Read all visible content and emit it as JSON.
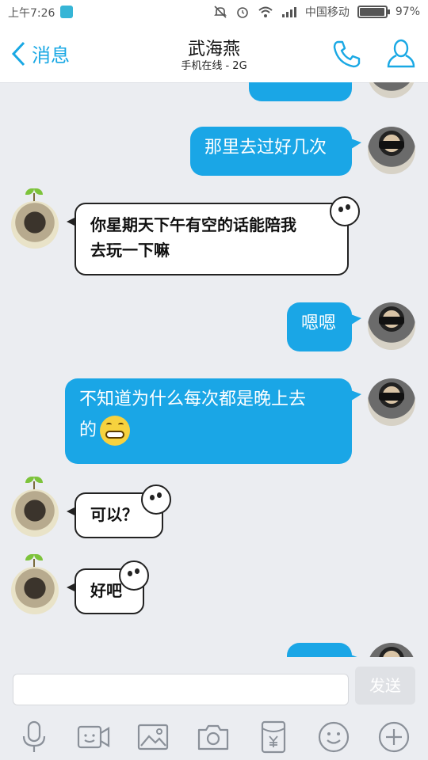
{
  "status_bar": {
    "time": "上午7:26",
    "carrier": "中国移动",
    "battery": "97%"
  },
  "header": {
    "back_label": "消息",
    "title": "武海燕",
    "subtitle": "手机在线 - 2G"
  },
  "messages": [
    {
      "side": "right",
      "style": "blue",
      "text": "那里去过好几次"
    },
    {
      "side": "left",
      "style": "white",
      "line1": "你星期天下午有空的话能陪我",
      "line2": "去玩一下嘛"
    },
    {
      "side": "right",
      "style": "blue",
      "text": "嗯嗯"
    },
    {
      "side": "right",
      "style": "blue",
      "line1": "不知道为什么每次都是晚上去",
      "line2": "的"
    },
    {
      "side": "left",
      "style": "white",
      "text": "可以？"
    },
    {
      "side": "left",
      "style": "white",
      "text": "好吧"
    }
  ],
  "composer": {
    "placeholder": "",
    "send_label": "发送"
  },
  "toolbar": [
    "microphone-icon",
    "video-icon",
    "image-icon",
    "camera-icon",
    "red-packet-icon",
    "emoji-icon",
    "plus-icon"
  ],
  "colors": {
    "accent": "#1aa6e6",
    "background": "#ebedf1"
  }
}
